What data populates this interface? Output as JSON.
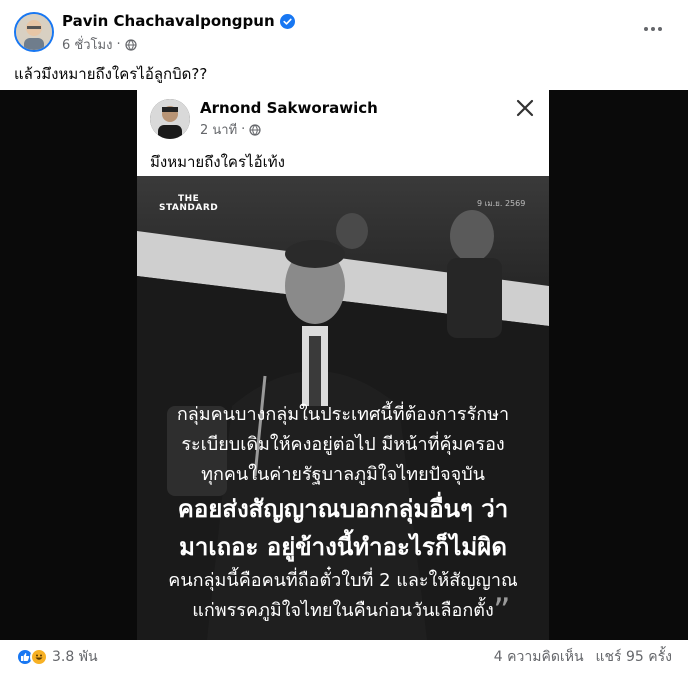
{
  "post": {
    "author": "Pavin Chachavalpongpun",
    "time": "6 ชั่วโมง",
    "caption": "แล้วมึงหมายถึงใครไอ้ลูกบิด??"
  },
  "shared": {
    "author": "Arnond Sakworawich",
    "time": "2 นาที",
    "caption": "มึงหมายถึงใครไอ้เท้ง",
    "brand_line1": "THE",
    "brand_line2": "STANDARD",
    "date": "9 เม.ย. 2569",
    "quote": {
      "l1": "กลุ่มคนบางกลุ่มในประเทศนี้ที่ต้องการรักษา",
      "l2": "ระเบียบเดิมให้คงอยู่ต่อไป มีหน้าที่คุ้มครอง",
      "l3": "ทุกคนในค่ายรัฐบาลภูมิใจไทยปัจจุบัน",
      "l4": "คอยส่งสัญญาณบอกกลุ่มอื่นๆ ว่า",
      "l5": "มาเถอะ อยู่ข้างนี้ทำอะไรก็ไม่ผิด",
      "l6": "คนกลุ่มนี้คือคนที่ถือตั๋วใบที่ 2 และให้สัญญาณ",
      "l7": "แก่พรรคภูมิใจไทยในคืนก่อนวันเลือกตั้ง"
    },
    "quote_mark": "”"
  },
  "footer": {
    "reaction_count": "3.8 พัน",
    "comments": "4 ความคิดเห็น",
    "shares": "แชร์ 95 ครั้ง"
  },
  "colors": {
    "accent": "#1877f2",
    "secondary_text": "#65676b"
  }
}
